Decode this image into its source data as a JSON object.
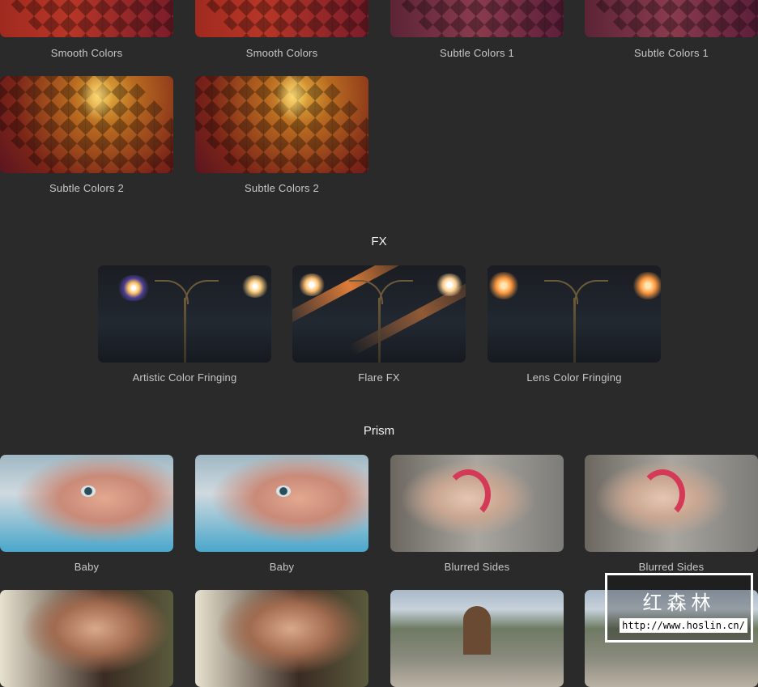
{
  "grid_top": {
    "row1_labels": [
      "Smooth Colors",
      "Smooth Colors",
      "Subtle Colors 1",
      "Subtle Colors 1"
    ],
    "row2_labels": [
      "Subtle Colors 2",
      "Subtle Colors 2"
    ]
  },
  "fx": {
    "title": "FX",
    "items": [
      "Artistic Color Fringing",
      "Flare FX",
      "Lens Color Fringing"
    ]
  },
  "prism": {
    "title": "Prism",
    "row1_labels": [
      "Baby",
      "Baby",
      "Blurred Sides",
      "Blurred Sides"
    ]
  },
  "watermark": {
    "brand_cn": "红森林",
    "url": "http://www.hoslin.cn/"
  },
  "colors": {
    "background": "#2a2a2a",
    "label_text": "#c8c8c8",
    "section_title": "#f2f2f2"
  },
  "icons": []
}
